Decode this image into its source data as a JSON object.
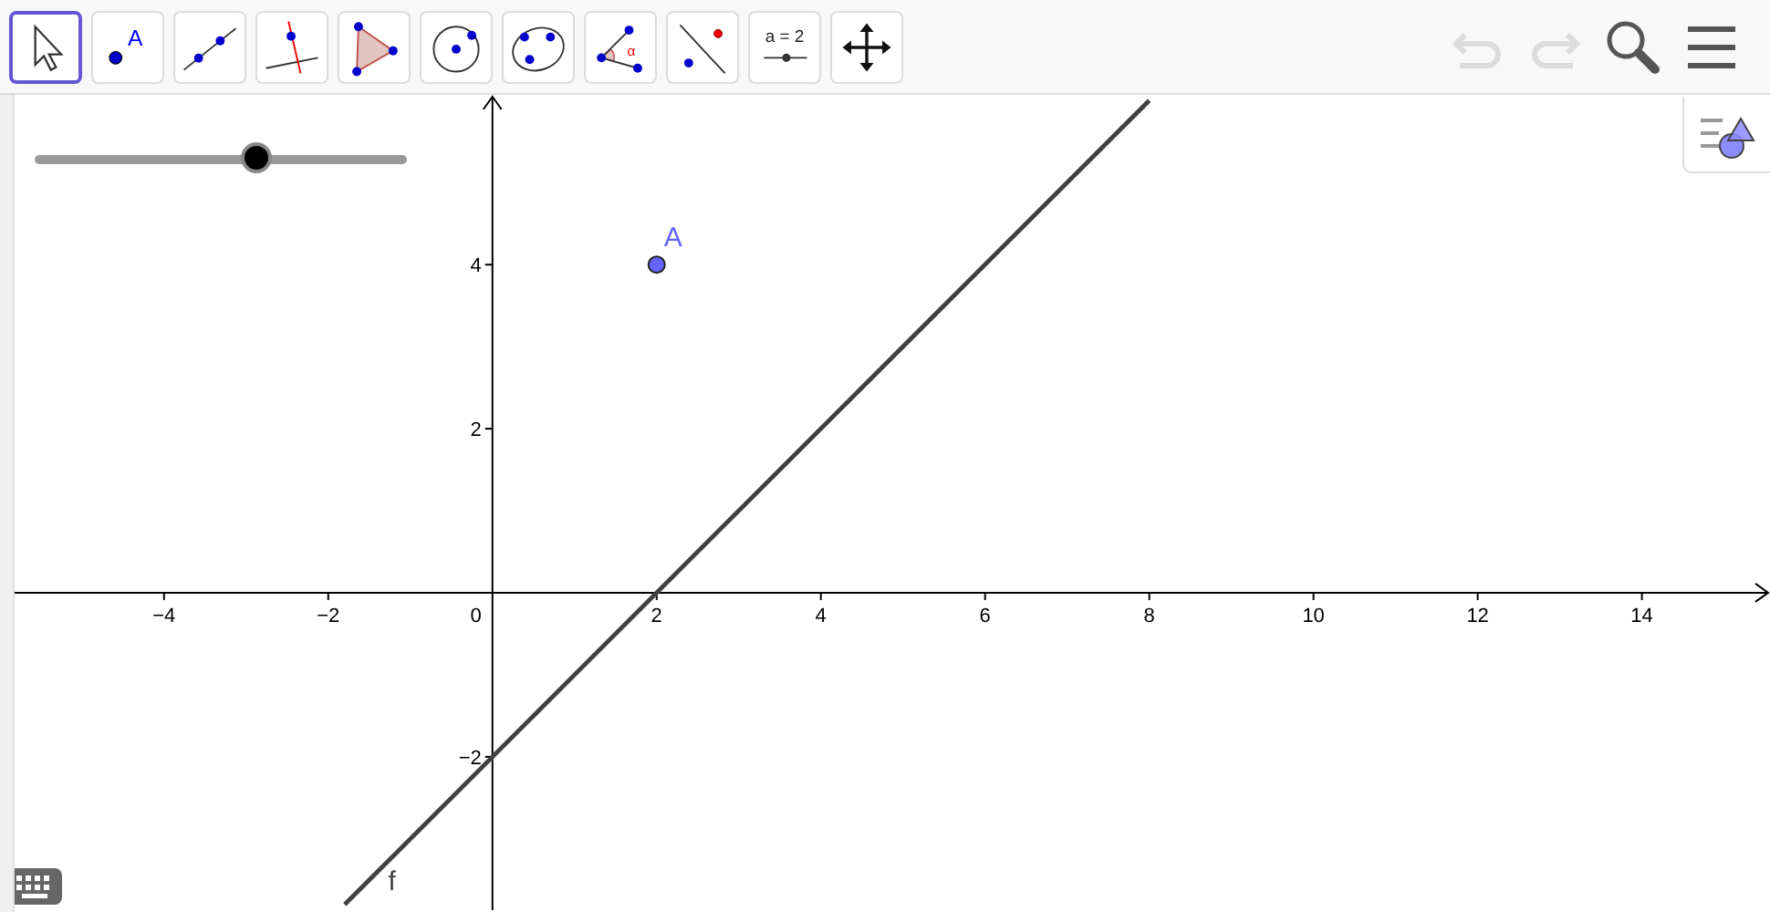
{
  "toolbar": {
    "tools": [
      {
        "kind": "move",
        "selected": true
      },
      {
        "kind": "point",
        "label": "A",
        "selected": false
      },
      {
        "kind": "line",
        "selected": false
      },
      {
        "kind": "perpendicular",
        "selected": false
      },
      {
        "kind": "polygon",
        "selected": false
      },
      {
        "kind": "circle",
        "selected": false
      },
      {
        "kind": "conic",
        "selected": false
      },
      {
        "kind": "angle",
        "label": "α",
        "selected": false
      },
      {
        "kind": "reflect",
        "selected": false
      },
      {
        "kind": "slider",
        "label": "a = 2",
        "selected": false
      },
      {
        "kind": "move_view",
        "selected": false
      }
    ],
    "undo": {
      "disabled": true
    },
    "redo": {
      "disabled": true
    }
  },
  "graphics": {
    "slider": {
      "level": 0.6
    },
    "origin_label": "0",
    "chart_data": {
      "type": "line",
      "xlim": [
        -5.82,
        15.56
      ],
      "ylim": [
        -3.87,
        6.07
      ],
      "xticks": [
        {
          "value": -4,
          "label": "−4"
        },
        {
          "value": -2,
          "label": "−2"
        },
        {
          "value": 2,
          "label": "2"
        },
        {
          "value": 4,
          "label": "4"
        },
        {
          "value": 6,
          "label": "6"
        },
        {
          "value": 8,
          "label": "8"
        },
        {
          "value": 10,
          "label": "10"
        },
        {
          "value": 12,
          "label": "12"
        },
        {
          "value": 14,
          "label": "14"
        }
      ],
      "yticks": [
        {
          "value": -2,
          "label": "−2"
        },
        {
          "value": 2,
          "label": "2"
        },
        {
          "value": 4,
          "label": "4"
        }
      ],
      "x": [
        -1.8,
        8
      ],
      "series": [
        {
          "name": "f",
          "color": "#404040",
          "values": [
            -3.8,
            6
          ]
        }
      ],
      "annotations": [
        {
          "text": "A",
          "x": 2,
          "y": 4
        }
      ]
    }
  }
}
